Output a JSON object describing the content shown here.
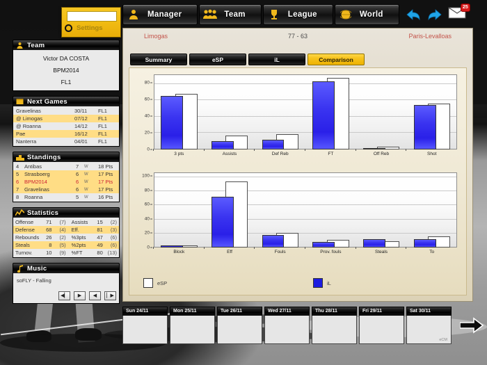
{
  "topnav": {
    "buttons": [
      {
        "label": "Manager",
        "icon": "manager-icon"
      },
      {
        "label": "Team",
        "icon": "team-group-icon"
      },
      {
        "label": "League",
        "icon": "trophy-icon"
      },
      {
        "label": "World",
        "icon": "globe-icon"
      }
    ],
    "back_icon": "back-arrow-icon",
    "forward_icon": "forward-arrow-icon",
    "mail_icon": "mail-envelope-icon",
    "mail_badge": "25"
  },
  "settings": {
    "label": "Settings",
    "input_value": "",
    "input_placeholder": ""
  },
  "sidebar": {
    "team": {
      "title": "Team",
      "icon": "person-icon",
      "manager_name": "Victor DA COSTA",
      "team_name": "BPM2014",
      "division": "FL1"
    },
    "next_games": {
      "title": "Next Games",
      "icon": "calendar-icon",
      "rows": [
        {
          "opponent": "Gravelinas",
          "date": "30/11",
          "comp": "FL1"
        },
        {
          "opponent": "@ Limogas",
          "date": "07/12",
          "comp": "FL1"
        },
        {
          "opponent": "@ Roanna",
          "date": "14/12",
          "comp": "FL1"
        },
        {
          "opponent": "Pae",
          "date": "16/12",
          "comp": "FL1"
        },
        {
          "opponent": "Nanterra",
          "date": "04/01",
          "comp": "FL1"
        }
      ]
    },
    "standings": {
      "title": "Standings",
      "icon": "podium-icon",
      "rows": [
        {
          "pos": "4",
          "team": "Antibas",
          "wins": "7",
          "w": "W",
          "pts": "18 Pts"
        },
        {
          "pos": "5",
          "team": "Strasboerg",
          "wins": "6",
          "w": "W",
          "pts": "17 Pts"
        },
        {
          "pos": "6",
          "team": "BPM2014",
          "wins": "6",
          "w": "W",
          "pts": "17 Pts"
        },
        {
          "pos": "7",
          "team": "Gravelinas",
          "wins": "6",
          "w": "W",
          "pts": "17 Pts"
        },
        {
          "pos": "8",
          "team": "Roanna",
          "wins": "5",
          "w": "W",
          "pts": "16 Pts"
        }
      ]
    },
    "statistics": {
      "title": "Statistics",
      "icon": "chart-line-icon",
      "rows": [
        {
          "k1": "Offense",
          "v1": "71",
          "r1": "(7)",
          "k2": "Assists",
          "v2": "15",
          "r2": "(2)"
        },
        {
          "k1": "Defense",
          "v1": "68",
          "r1": "(4)",
          "k2": "Eff.",
          "v2": "81",
          "r2": "(3)"
        },
        {
          "k1": "Rebounds",
          "v1": "26",
          "r1": "(2)",
          "k2": "%3pts",
          "v2": "47",
          "r2": "(6)"
        },
        {
          "k1": "Steals",
          "v1": "8",
          "r1": "(5)",
          "k2": "%2pts",
          "v2": "49",
          "r2": "(6)"
        },
        {
          "k1": "Turnov.",
          "v1": "10",
          "r1": "(9)",
          "k2": "%FT",
          "v2": "80",
          "r2": "(13)"
        }
      ]
    },
    "music": {
      "title": "Music",
      "icon": "music-note-icon",
      "track": "soFLY - Falling",
      "buttons": [
        {
          "name": "music-prev-button",
          "glyph": "◀▏"
        },
        {
          "name": "music-play-button",
          "glyph": "▶"
        },
        {
          "name": "music-back-button",
          "glyph": "◀"
        },
        {
          "name": "music-next-button",
          "glyph": "▏▶"
        }
      ]
    }
  },
  "match": {
    "home_team": "Limogas",
    "away_team": "Paris-Levalloas",
    "score": "77  -  63",
    "tabs": [
      {
        "label": "Summary",
        "active": false
      },
      {
        "label": "eSP",
        "active": false
      },
      {
        "label": "iL",
        "active": false
      },
      {
        "label": "Comparison",
        "active": true
      }
    ]
  },
  "legend": {
    "esp_label": "eSP",
    "il_label": "iL",
    "esp_color": "#ffffff",
    "il_color": "#1c1ce0"
  },
  "chart_data": [
    {
      "type": "bar",
      "title": "",
      "categories": [
        "3 pts",
        "Assists",
        "Def Reb",
        "FT",
        "Off Reb",
        "Shot"
      ],
      "series": [
        {
          "name": "iL",
          "values": [
            64,
            10,
            12,
            82,
            1,
            53
          ]
        },
        {
          "name": "eSP",
          "values": [
            67,
            17,
            18,
            86,
            3,
            55
          ]
        }
      ],
      "yticks": [
        0,
        20,
        40,
        60,
        80
      ],
      "ylim": [
        0,
        90
      ],
      "xlabel": "",
      "ylabel": "",
      "grid": true,
      "legend_position": "bottom"
    },
    {
      "type": "bar",
      "title": "",
      "categories": [
        "Block",
        "Eff",
        "Fouls",
        "Prov. fouls",
        "Steals",
        "To"
      ],
      "series": [
        {
          "name": "iL",
          "values": [
            3,
            71,
            18,
            8,
            12,
            12
          ]
        },
        {
          "name": "eSP",
          "values": [
            3,
            92,
            20,
            11,
            9,
            16
          ]
        }
      ],
      "yticks": [
        0,
        20,
        40,
        60,
        80,
        100
      ],
      "ylim": [
        0,
        105
      ],
      "xlabel": "",
      "ylabel": "",
      "grid": true,
      "legend_position": "bottom"
    }
  ],
  "calendar": {
    "days": [
      {
        "label": "Sun 24/11",
        "note": ""
      },
      {
        "label": "Mon 25/11",
        "note": ""
      },
      {
        "label": "Tue 26/11",
        "note": ""
      },
      {
        "label": "Wed 27/11",
        "note": ""
      },
      {
        "label": "Thu 28/11",
        "note": ""
      },
      {
        "label": "Fri 29/11",
        "note": ""
      },
      {
        "label": "Sat 30/11",
        "note": "eCM"
      }
    ],
    "next_icon": "right-arrow-icon"
  }
}
